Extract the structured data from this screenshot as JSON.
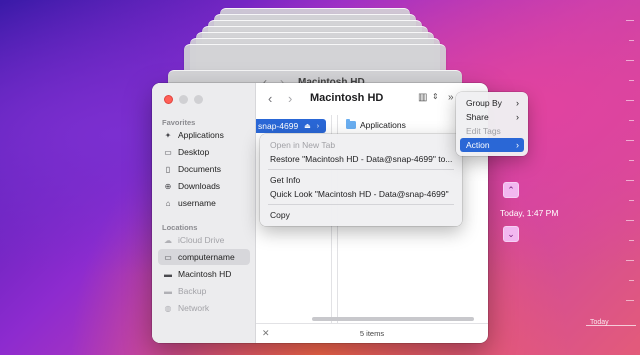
{
  "window": {
    "title": "Macintosh HD",
    "status": "5 items",
    "stack_title": "Macintosh HD"
  },
  "sidebar": {
    "favorites_label": "Favorites",
    "favorites": [
      {
        "label": "Applications",
        "icon": "applications-icon"
      },
      {
        "label": "Desktop",
        "icon": "desktop-icon"
      },
      {
        "label": "Documents",
        "icon": "document-icon"
      },
      {
        "label": "Downloads",
        "icon": "downloads-icon"
      },
      {
        "label": "username",
        "icon": "home-icon"
      }
    ],
    "locations_label": "Locations",
    "locations": [
      {
        "label": "iCloud Drive",
        "icon": "cloud-icon",
        "dim": true
      },
      {
        "label": "computername",
        "icon": "computer-icon",
        "selected": true
      },
      {
        "label": "Macintosh HD",
        "icon": "disk-icon"
      },
      {
        "label": "Backup",
        "icon": "disk-icon",
        "dim": true
      },
      {
        "label": "Network",
        "icon": "network-icon",
        "dim": true
      }
    ]
  },
  "columns": {
    "selected": "snap-4699",
    "files": [
      "Applications"
    ]
  },
  "context_menu": {
    "items": [
      "Open in New Tab",
      "Restore \"Macintosh HD - Data@snap-4699\" to...",
      "Get Info",
      "Quick Look \"Macintosh HD - Data@snap-4699\"",
      "Copy"
    ]
  },
  "toolbar_menu": {
    "items": [
      "Group By",
      "Share",
      "Edit Tags",
      "Action"
    ]
  },
  "time_machine": {
    "time_label": "Today, 1:47 PM",
    "today_label": "Today"
  }
}
